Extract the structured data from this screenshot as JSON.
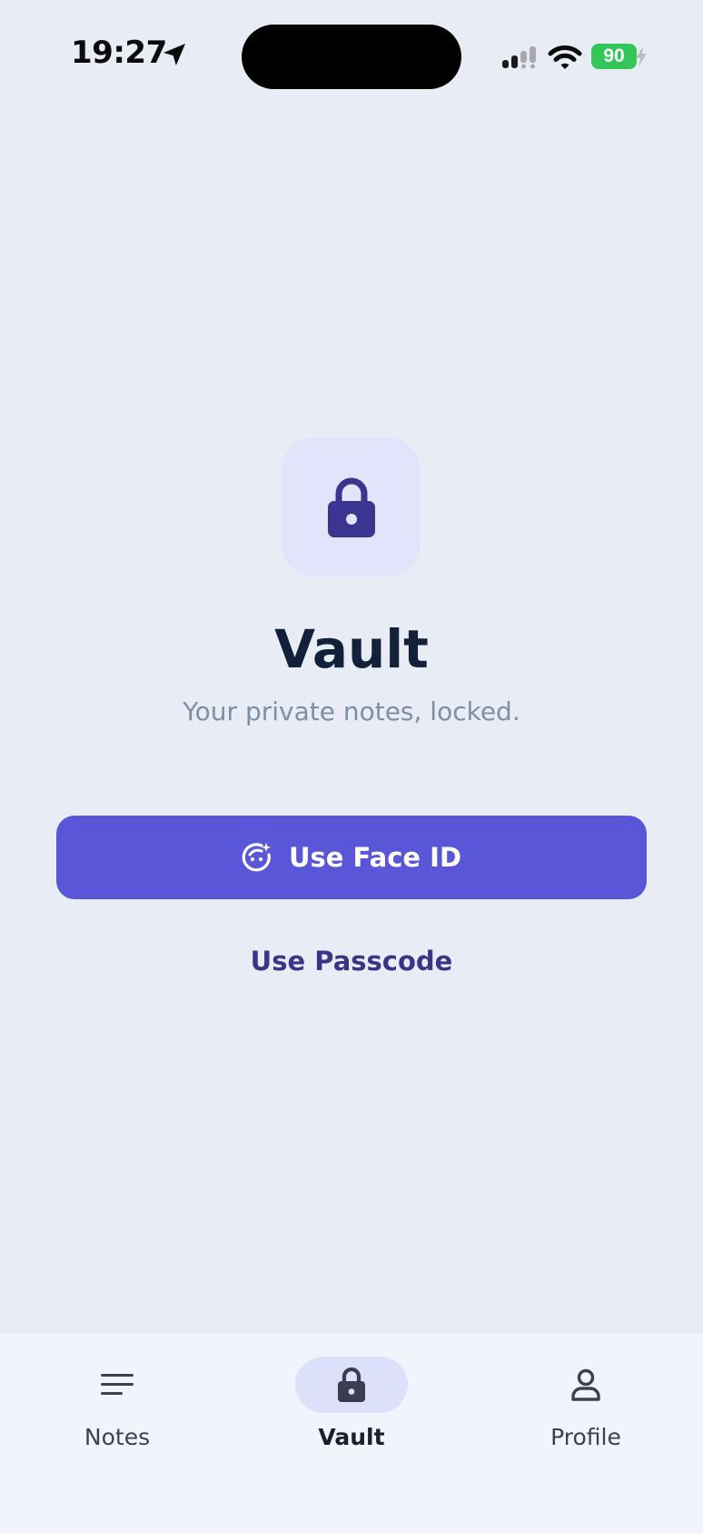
{
  "status_bar": {
    "time": "19:27",
    "battery_level": "90",
    "battery_color": "#33c759",
    "icons": [
      "location-arrow-icon",
      "signal-icon",
      "wifi-icon",
      "battery-icon"
    ]
  },
  "main": {
    "lock_icon": "lock-icon",
    "title": "Vault",
    "subtitle": "Your private notes, locked.",
    "face_id_button": {
      "label": "Use Face ID",
      "icon": "face-id-icon"
    },
    "passcode_link": "Use Passcode"
  },
  "tab_bar": {
    "tabs": [
      {
        "label": "Notes",
        "icon": "notes-lines-icon",
        "active": false
      },
      {
        "label": "Vault",
        "icon": "lock-icon",
        "active": true
      },
      {
        "label": "Profile",
        "icon": "person-icon",
        "active": false
      }
    ]
  },
  "colors": {
    "background": "#e8ecf5",
    "accent": "#5a56d8",
    "lock_tile": "#e4e3fc",
    "lock_icon": "#3a3591",
    "title": "#13203a",
    "subtitle": "#7d8ea8",
    "tab_active_pill": "#dde0fa"
  }
}
